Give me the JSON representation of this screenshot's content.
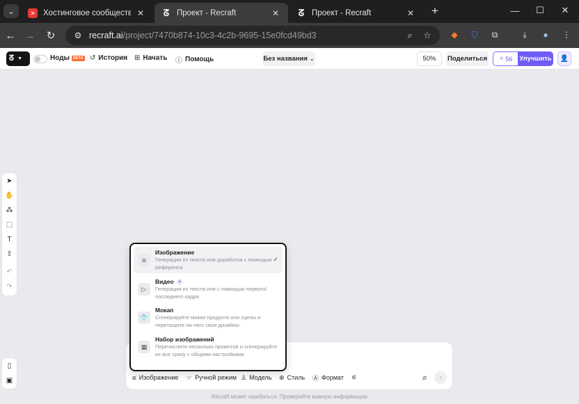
{
  "browser": {
    "tabs": [
      {
        "title": "Хостинговое сообщество «Tim",
        "active": false
      },
      {
        "title": "Проект - Recraft",
        "active": true
      },
      {
        "title": "Проект - Recraft",
        "active": false
      }
    ],
    "url_host": "recraft.ai",
    "url_path": "/project/7470b874-10c3-4c2b-9695-15e0fcd49bd3"
  },
  "header": {
    "nodes_label": "Ноды",
    "beta_label": "BETA",
    "history_label": "История",
    "start_label": "Начать",
    "help_label": "Помощь",
    "document_name": "Без названия",
    "zoom": "50%",
    "share_label": "Поделиться",
    "credits": "56",
    "upgrade_label": "Улучшить"
  },
  "menu": {
    "items": [
      {
        "title": "Изображение",
        "description": "Генерация из текста или доработка с помощью референса",
        "selected": true
      },
      {
        "title": "Видео",
        "description": "Генерация из текста или с помощью первого/последнего кадра",
        "selected": false
      },
      {
        "title": "Мокап",
        "description": "Сгенерируйте мокап продукта или сцены и перетащите на него свои дизайны",
        "selected": false
      },
      {
        "title": "Набор изображений",
        "description": "Перечислите несколько промптов и сгенерируйте их все сразу с общими настройками",
        "selected": false
      }
    ]
  },
  "prompt_bar": {
    "image_label": "Изображение",
    "manual_label": "Ручной режим",
    "model_label": "Модель",
    "style_label": "Стиль",
    "format_label": "Формат"
  },
  "disclaimer": "Recraft может ошибаться. Проверяйте важную информацию",
  "colors": {
    "accent": "#6f5cf6",
    "beta": "#ff6a2c",
    "tab_favicon_red": "#e53935"
  }
}
